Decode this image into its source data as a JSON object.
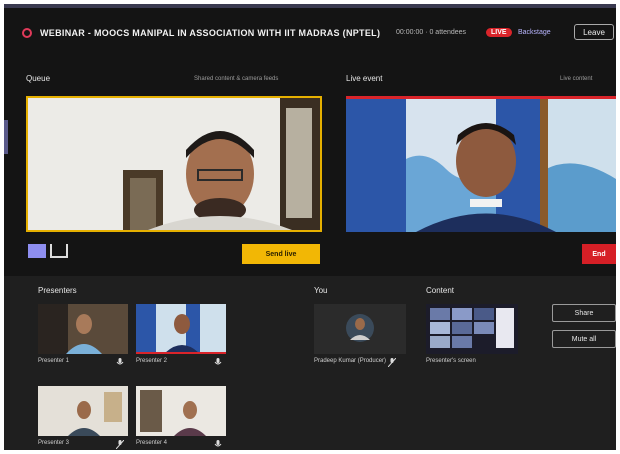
{
  "header": {
    "title": "WEBINAR - MOOCS MANIPAL IN ASSOCIATION WITH IIT MADRAS (NPTEL)",
    "meta": "00:00:00 · 0 attendees",
    "live_badge": "LIVE",
    "backstage_link": "Backstage",
    "leave_label": "Leave"
  },
  "queue": {
    "label": "Queue",
    "meta": "Shared content & camera feeds",
    "send_live_label": "Send live"
  },
  "live_event": {
    "label": "Live event",
    "meta": "Live content",
    "end_label": "End"
  },
  "presenters": {
    "label": "Presenters",
    "items": [
      {
        "name": "Presenter 1"
      },
      {
        "name": "Presenter 2"
      },
      {
        "name": "Presenter 3"
      },
      {
        "name": "Presenter 4"
      }
    ]
  },
  "you": {
    "label": "You",
    "name": "Pradeep Kumar (Producer)"
  },
  "content": {
    "label": "Content",
    "name": "Presenter's screen"
  },
  "side_buttons": {
    "share_label": "Share",
    "mute_all_label": "Mute all"
  },
  "colors": {
    "background": "#141414",
    "panel": "#1f1f1f",
    "queue_border": "#e6b000",
    "live_red": "#d9242a",
    "accent": "#8e8ef0"
  },
  "icons": {
    "mic": "mic-icon",
    "mic_off": "mic-off-icon",
    "live_dot": "live-dot-icon"
  }
}
